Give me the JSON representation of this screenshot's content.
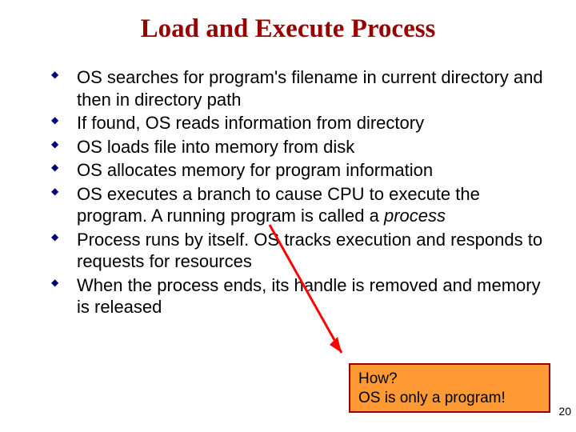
{
  "title": "Load and Execute Process",
  "bullets": [
    {
      "text": "OS searches for program's filename in current directory and then in directory path"
    },
    {
      "text": "If found, OS reads information from directory"
    },
    {
      "text": "OS loads file into memory from disk"
    },
    {
      "text": "OS allocates memory for program information"
    },
    {
      "text_pre": "OS executes a branch to cause CPU to execute the program. A running program is called a ",
      "italic": "process"
    },
    {
      "text": "Process runs by itself. OS tracks execution and responds to requests for resources"
    },
    {
      "text": "When the process ends, its handle is removed and memory is released"
    }
  ],
  "callout": {
    "line1": "How?",
    "line2": "OS is only a program!"
  },
  "page_number": "20",
  "accent_color": "#990000",
  "bullet_color": "#000080",
  "callout_bg": "#ff9933"
}
